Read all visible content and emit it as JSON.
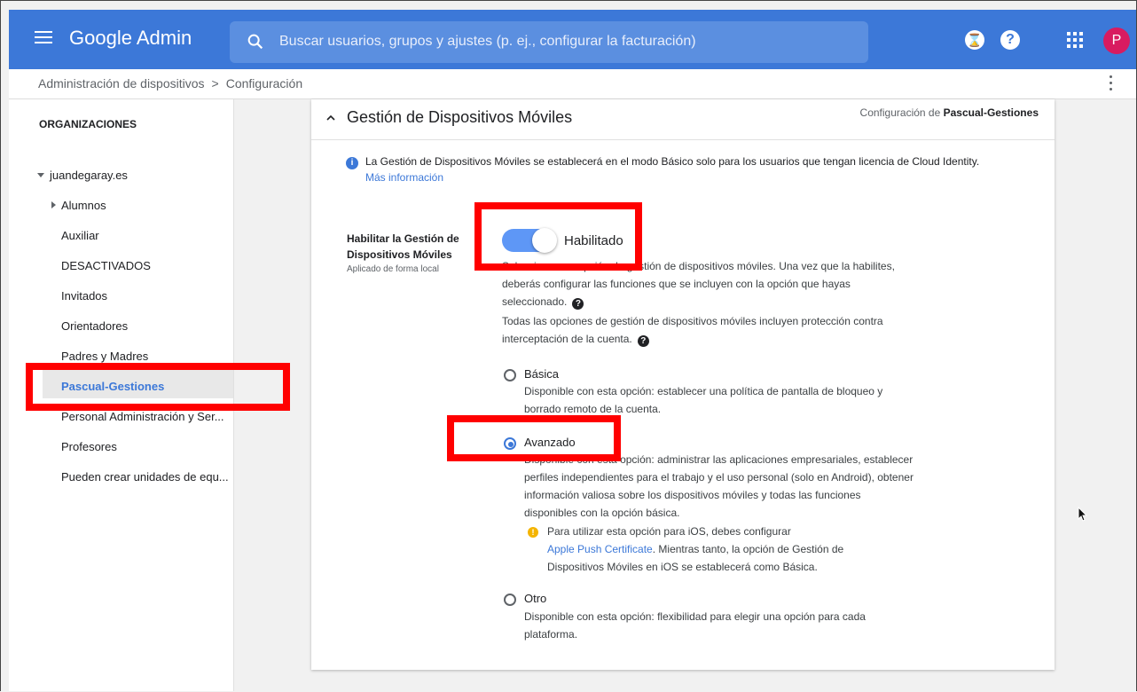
{
  "header": {
    "app_title": "Google Admin",
    "search_placeholder": "Buscar usuarios, grupos y ajustes (p. ej., configurar la facturación)",
    "avatar_letter": "P",
    "hourglass_glyph": "⌛",
    "help_glyph": "?"
  },
  "breadcrumb": {
    "items": [
      "Administración de dispositivos",
      "Configuración"
    ],
    "separator": ">"
  },
  "sidebar": {
    "title": "ORGANIZACIONES",
    "root": "juandegaray.es",
    "items": [
      "Alumnos",
      "Auxiliar",
      "DESACTIVADOS",
      "Invitados",
      "Orientadores",
      "Padres y Madres",
      "Pascual-Gestiones",
      "Personal Administración y Ser...",
      "Profesores",
      "Pueden crear unidades de equ..."
    ],
    "selected": "Pascual-Gestiones"
  },
  "card": {
    "title": "Gestión de Dispositivos Móviles",
    "config_prefix": "Configuración de",
    "config_org": "Pascual-Gestiones",
    "info_text": "La Gestión de Dispositivos Móviles se establecerá en el modo Básico solo para los usuarios que tengan licencia de Cloud Identity.",
    "info_link": "Más información",
    "setting_label": "Habilitar la Gestión de Dispositivos Móviles",
    "setting_sub": "Aplicado de forma local",
    "toggle_state": "Habilitado",
    "desc1": "Seleccione una opción de gestión de dispositivos móviles. Una vez que la habilites, deberás configurar las funciones que se incluyen con la opción que hayas seleccionado.",
    "desc2": "Todas las opciones de gestión de dispositivos móviles incluyen protección contra interceptación de la cuenta.",
    "options": [
      {
        "label": "Básica",
        "desc": "Disponible con esta opción: establecer una política de pantalla de bloqueo y borrado remoto de la cuenta.",
        "selected": false
      },
      {
        "label": "Avanzado",
        "desc": "Disponible con esta opción: administrar las aplicaciones empresariales, establecer perfiles independientes para el trabajo y el uso personal (solo en Android), obtener información valiosa sobre los dispositivos móviles y todas las funciones disponibles con la opción básica.",
        "selected": true
      },
      {
        "label": "Otro",
        "desc": "Disponible con esta opción: flexibilidad para elegir una opción para cada plataforma.",
        "selected": false
      }
    ],
    "warning_pre": "Para utilizar esta opción para iOS, debes configurar",
    "warning_link": "Apple Push Certificate",
    "warning_post": ". Mientras tanto, la opción de Gestión de Dispositivos Móviles en iOS se establecerá como Básica."
  },
  "colors": {
    "header_bg": "#3c78d8",
    "accent": "#3c78d8",
    "annotation": "#ff0000",
    "avatar": "#d81b60",
    "warning": "#f4b400"
  }
}
